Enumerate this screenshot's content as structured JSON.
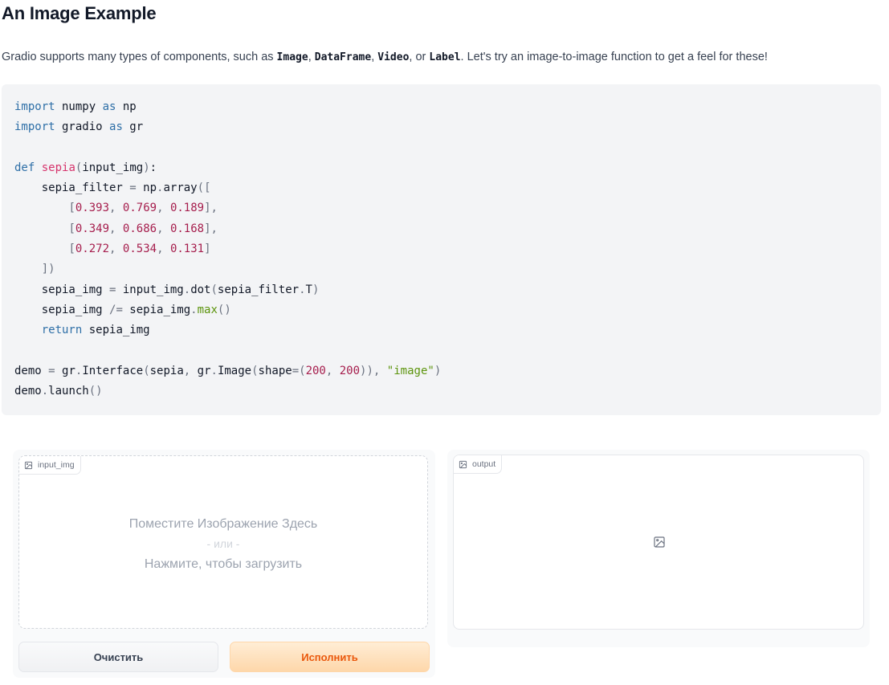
{
  "page": {
    "title": "An Image Example",
    "intro": {
      "before": "Gradio supports many types of components, such as ",
      "c1": "Image",
      "sep1": ", ",
      "c2": "DataFrame",
      "sep2": ", ",
      "c3": "Video",
      "sep3": ", or ",
      "c4": "Label",
      "after": ". Let's try an image-to-image function to get a feel for these!"
    }
  },
  "code": {
    "language": "python",
    "lines": [
      "import numpy as np",
      "import gradio as gr",
      "",
      "def sepia(input_img):",
      "    sepia_filter = np.array([",
      "        [0.393, 0.769, 0.189],",
      "        [0.349, 0.686, 0.168],",
      "        [0.272, 0.534, 0.131]",
      "    ])",
      "    sepia_img = input_img.dot(sepia_filter.T)",
      "    sepia_img /= sepia_img.max()",
      "    return sepia_img",
      "",
      "demo = gr.Interface(sepia, gr.Image(shape=(200, 200)), \"image\")",
      "demo.launch()"
    ]
  },
  "demo": {
    "input": {
      "label": "input_img",
      "drop_text": "Поместите Изображение Здесь",
      "or_text": "- или -",
      "click_text": "Нажмите, чтобы загрузить"
    },
    "output": {
      "label": "output"
    },
    "buttons": {
      "clear": "Очистить",
      "submit": "Исполнить"
    },
    "colors": {
      "submit_text": "#ea580c",
      "submit_bg": "#fed7aa",
      "code_bg": "#f3f4f6"
    },
    "icons": {
      "label_icon": "image-icon",
      "output_placeholder": "image-icon"
    }
  }
}
